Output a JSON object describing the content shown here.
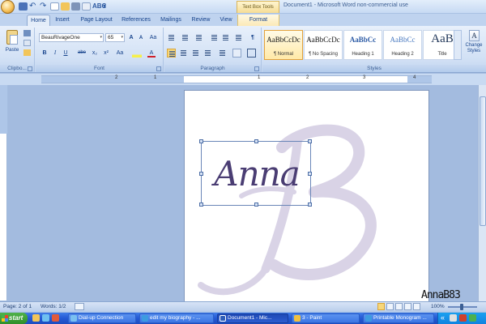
{
  "titlebar": {
    "contextual_tools": "Text Box Tools",
    "window_title": "Document1 - Microsoft Word non-commercial use",
    "qat_undo": "↶",
    "qat_redo": "↷",
    "qat_spell": "ABC",
    "qat_more": "▾"
  },
  "tabs": [
    "Home",
    "Insert",
    "Page Layout",
    "References",
    "Mailings",
    "Review",
    "View",
    "Format"
  ],
  "ribbon": {
    "clipboard": {
      "paste_label": "Paste",
      "group_label": "Clipbo..."
    },
    "font": {
      "font_name": "BeauRivageOne",
      "font_size": "65",
      "group_label": "Font",
      "grow": "A",
      "shrink": "A",
      "clear": "Aa",
      "bold": "B",
      "italic": "I",
      "underline": "U",
      "strike": "abe",
      "subscript": "x₂",
      "superscript": "x²",
      "change_case": "Aa",
      "font_color": "A"
    },
    "paragraph": {
      "group_label": "Paragraph",
      "show_marks": "¶"
    },
    "styles": {
      "group_label": "Styles",
      "items": [
        {
          "sample": "AaBbCcDc",
          "name": "¶ Normal"
        },
        {
          "sample": "AaBbCcDc",
          "name": "¶ No Spacing"
        },
        {
          "sample": "AaBbCc",
          "name": "Heading 1"
        },
        {
          "sample": "AaBbCc",
          "name": "Heading 2"
        },
        {
          "sample": "AaB",
          "name": "Title"
        }
      ],
      "change_styles": "Change Styles"
    }
  },
  "ruler": {
    "numbers": [
      "2",
      "1",
      "1",
      "2",
      "3",
      "4"
    ]
  },
  "document": {
    "textbox_text": "Anna",
    "monogram_letter": "B"
  },
  "statusbar": {
    "page": "Page: 2 of 1",
    "words": "Words: 1/2",
    "zoom": "100%"
  },
  "watermark": "AnnaB83",
  "taskbar": {
    "start": "start",
    "windows": [
      {
        "label": "Dial-up Connection",
        "active": false
      },
      {
        "label": "edit my biography - ...",
        "active": false
      },
      {
        "label": "Document1 - Mic...",
        "active": true
      },
      {
        "label": "3 - Paint",
        "active": false
      },
      {
        "label": "Printable Monogram ...",
        "active": false
      }
    ],
    "tray_text": "«"
  },
  "colors": {
    "accent": "#15428b",
    "monogram": "#d9d3e6",
    "text_box_font": "#4a3d73",
    "taskbar": "#2459d4",
    "start": "#3c9e37"
  }
}
